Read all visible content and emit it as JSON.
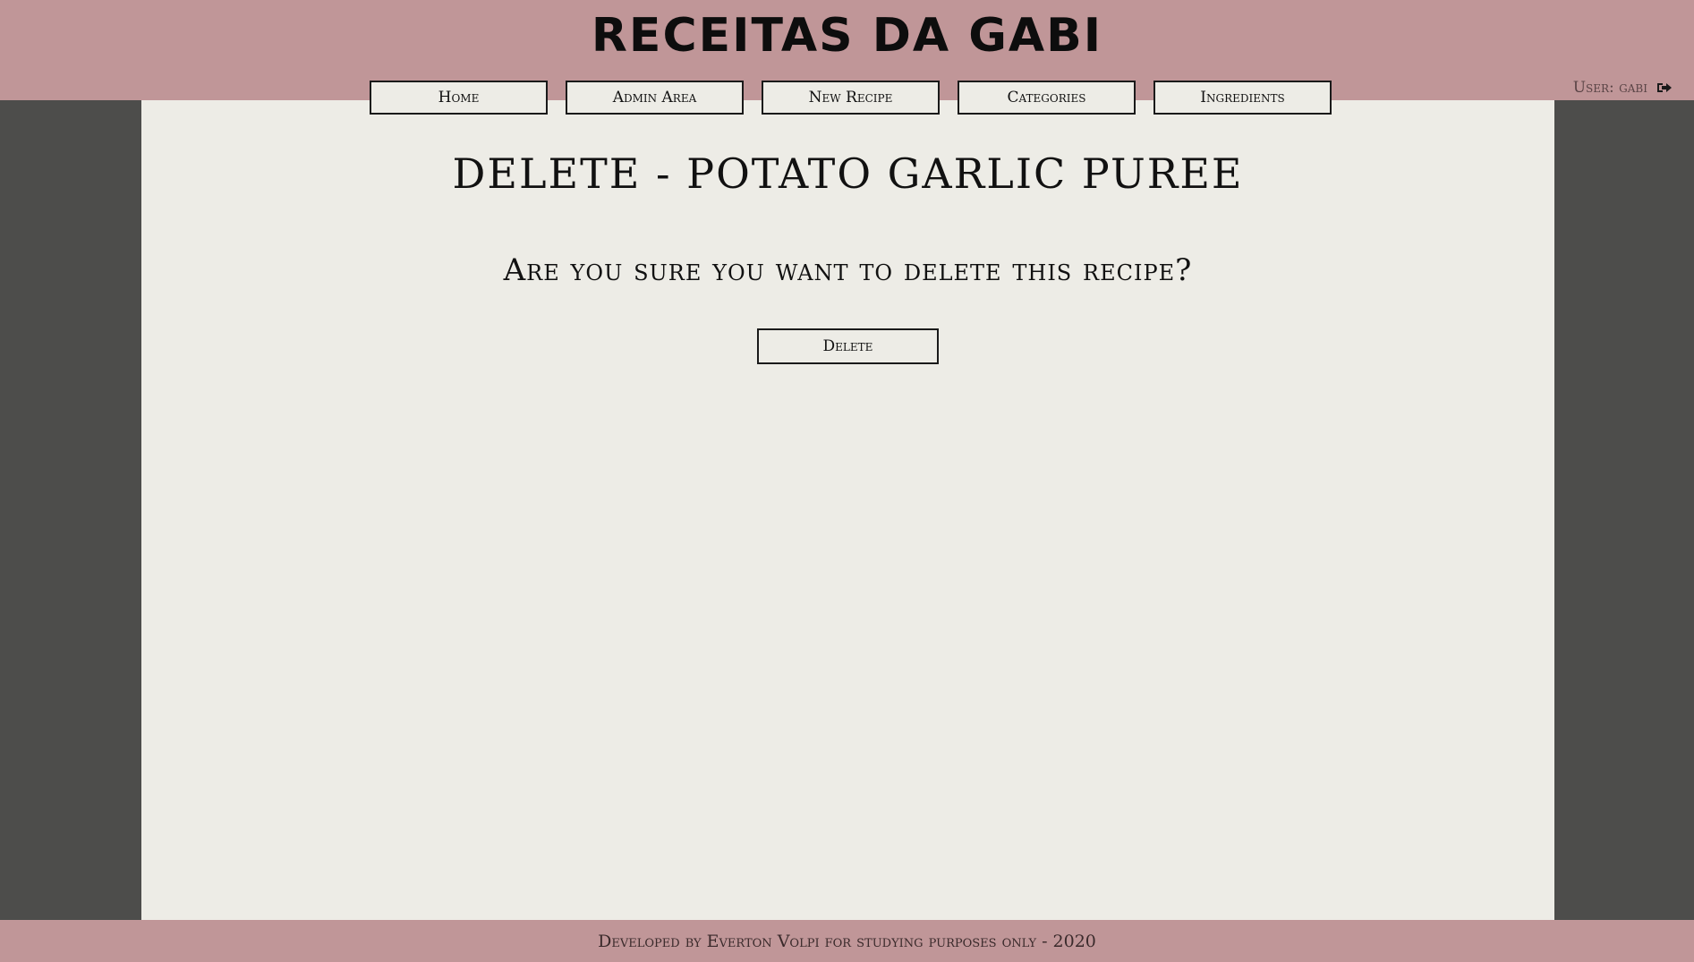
{
  "header": {
    "site_title": "RECEITAS DA GABI",
    "nav": [
      {
        "label": "Home"
      },
      {
        "label": "Admin Area"
      },
      {
        "label": "New Recipe"
      },
      {
        "label": "Categories"
      },
      {
        "label": "Ingredients"
      }
    ],
    "user_label": "User: gabi",
    "logout_icon": "sign-out-icon"
  },
  "main": {
    "title": "DELETE - POTATO GARLIC PUREE",
    "confirm_text": "Are you sure you want to delete this recipe?",
    "delete_label": "Delete"
  },
  "footer": {
    "text": "Developed by Everton Volpi for studying purposes only - 2020"
  },
  "colors": {
    "header_bg": "#c09698",
    "side_bg": "#4d4d4b",
    "content_bg": "#edece6"
  }
}
